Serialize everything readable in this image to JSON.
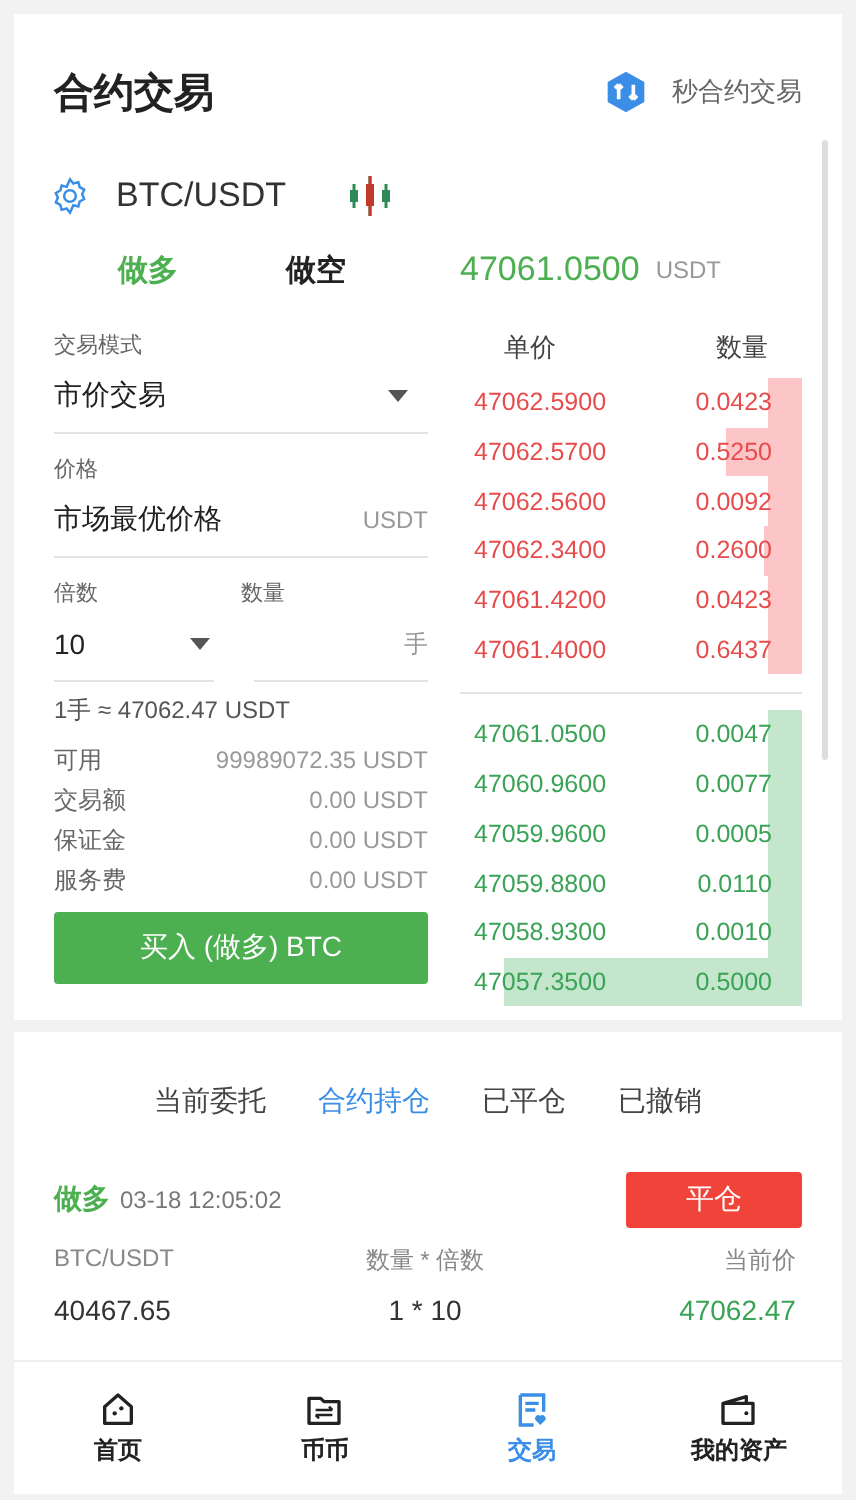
{
  "header": {
    "title": "合约交易",
    "link": "秒合约交易"
  },
  "pair": "BTC/USDT",
  "sides": [
    {
      "label": "做多",
      "selected": true
    },
    {
      "label": "做空",
      "selected": false
    }
  ],
  "last_price": {
    "value": "47061.0500",
    "unit": "USDT"
  },
  "form": {
    "mode": {
      "label": "交易模式",
      "value": "市价交易"
    },
    "price": {
      "label": "价格",
      "value": "市场最优价格",
      "unit": "USDT"
    },
    "leverage": {
      "label": "倍数",
      "value": "10"
    },
    "quantity": {
      "label": "数量",
      "unit": "手"
    },
    "lot_note": "1手 ≈ 47062.47 USDT",
    "summary": [
      {
        "label": "可用",
        "value": "99989072.35 USDT"
      },
      {
        "label": "交易额",
        "value": "0.00 USDT"
      },
      {
        "label": "保证金",
        "value": "0.00 USDT"
      },
      {
        "label": "服务费",
        "value": "0.00 USDT"
      }
    ],
    "submit": "买入 (做多) BTC"
  },
  "order_book": {
    "columns": [
      "单价",
      "数量"
    ],
    "asks": [
      {
        "price": "47062.5900",
        "amount": "0.0423"
      },
      {
        "price": "47062.5700",
        "amount": "0.5250"
      },
      {
        "price": "47062.5600",
        "amount": "0.0092"
      },
      {
        "price": "47062.3400",
        "amount": "0.2600"
      },
      {
        "price": "47061.4200",
        "amount": "0.0423"
      },
      {
        "price": "47061.4000",
        "amount": "0.6437"
      }
    ],
    "bids": [
      {
        "price": "47061.0500",
        "amount": "0.0047"
      },
      {
        "price": "47060.9600",
        "amount": "0.0077"
      },
      {
        "price": "47059.9600",
        "amount": "0.0005"
      },
      {
        "price": "47059.8800",
        "amount": "0.0110"
      },
      {
        "price": "47058.9300",
        "amount": "0.0010"
      },
      {
        "price": "47057.3500",
        "amount": "0.5000"
      }
    ]
  },
  "order_tabs": [
    {
      "label": "当前委托",
      "selected": false
    },
    {
      "label": "合约持仓",
      "selected": true
    },
    {
      "label": "已平仓",
      "selected": false
    },
    {
      "label": "已撤销",
      "selected": false
    }
  ],
  "position": {
    "side": "做多",
    "time": "03-18 12:05:02",
    "close_button": "平仓",
    "columns": [
      "BTC/USDT",
      "数量 * 倍数",
      "当前价"
    ],
    "values": [
      "40467.65",
      "1 * 10",
      "47062.47"
    ]
  },
  "nav": [
    {
      "label": "首页",
      "selected": false
    },
    {
      "label": "币币",
      "selected": false
    },
    {
      "label": "交易",
      "selected": true
    },
    {
      "label": "我的资产",
      "selected": false
    }
  ]
}
